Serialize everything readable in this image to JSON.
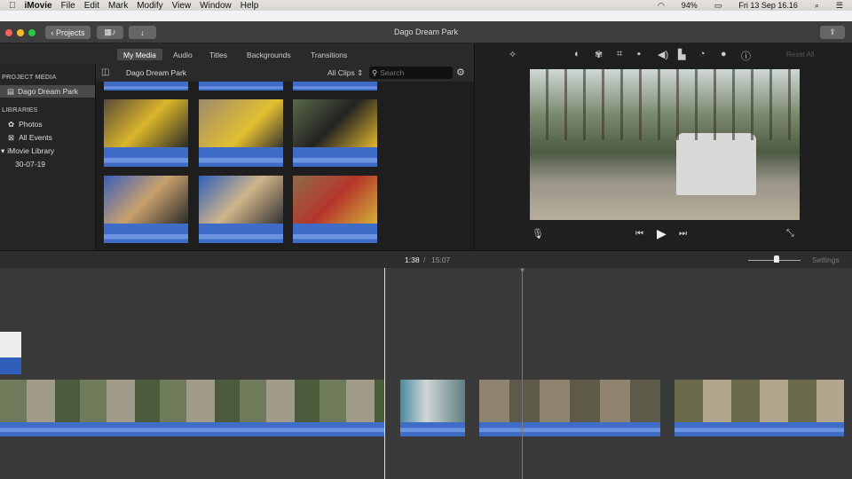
{
  "menubar": {
    "app": "iMovie",
    "items": [
      "File",
      "Edit",
      "Mark",
      "Modify",
      "View",
      "Window",
      "Help"
    ],
    "battery": "94%",
    "datetime": "Fri 13 Sep  16.16"
  },
  "window": {
    "title": "Dago Dream Park",
    "projects_button": "Projects"
  },
  "tabs": [
    "My Media",
    "Audio",
    "Titles",
    "Backgrounds",
    "Transitions"
  ],
  "sidebar": {
    "project_media_header": "PROJECT MEDIA",
    "project": "Dago Dream Park",
    "libraries_header": "LIBRARIES",
    "items": [
      "Photos",
      "All Events",
      "iMovie Library",
      "30-07-19"
    ]
  },
  "browser": {
    "title": "Dago Dream Park",
    "filter": "All Clips",
    "search_placeholder": "Search"
  },
  "viewer": {
    "reset_all": "Reset All",
    "tools": [
      "magic-wand",
      "color-balance",
      "color-correction",
      "crop",
      "stabilization",
      "volume",
      "noise-reduction",
      "speed",
      "clip-filter",
      "info"
    ]
  },
  "timeline": {
    "current_time": "1:38",
    "separator": "/",
    "total_time": "15:07",
    "settings": "Settings",
    "zoom_level": 0.55
  },
  "colors": {
    "accent": "#3e6cc6",
    "selected_tab": "#4a4a4a"
  }
}
